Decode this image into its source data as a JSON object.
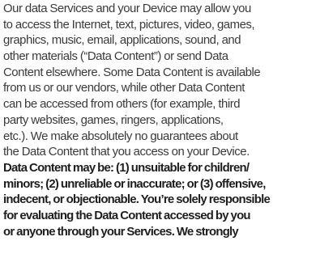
{
  "document": {
    "lines": [
      "Our data Services and your Device may allow you",
      "to access the Internet, text, pictures, video, games,",
      "graphics, music, email, applications, sound, and",
      "other materials (“Data Content”) or send Data",
      "Content elsewhere. Some Data Content is available",
      "from us or our vendors, while other Data Content",
      "can be accessed from others (for example, third",
      "party websites, games, ringers, applications,",
      "etc.). We make absolutely no guarantees about",
      "the Data Content that you access on your Device."
    ],
    "bold_lines": [
      "Data Content may be: (1) unsuitable for children/",
      "minors; (2) unreliable or inaccurate; or (3) offensive,",
      "indecent, or objectionable. You’re solely responsible",
      "for evaluating the Data Content accessed by you",
      "or anyone through your Services. We strongly"
    ]
  }
}
